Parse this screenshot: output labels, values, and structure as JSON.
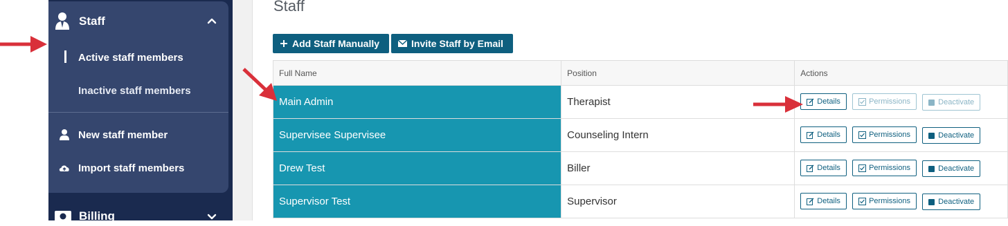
{
  "sidebar": {
    "staff_section": {
      "label": "Staff",
      "icon": "staff-person-icon",
      "expanded": true
    },
    "sub_items": [
      {
        "label": "Active staff members",
        "active": true
      },
      {
        "label": "Inactive staff members",
        "active": false
      }
    ],
    "menu_items": [
      {
        "label": "New staff member",
        "icon": "person-icon"
      },
      {
        "label": "Import staff members",
        "icon": "cloud-upload-icon"
      }
    ],
    "billing_section": {
      "label": "Billing",
      "icon": "money-icon",
      "expanded": false
    }
  },
  "main": {
    "title": "Staff",
    "buttons": {
      "add_manually": "Add Staff Manually",
      "invite_email": "Invite Staff by Email"
    },
    "table": {
      "headers": {
        "name": "Full Name",
        "position": "Position",
        "actions": "Actions"
      },
      "rows": [
        {
          "name": "Main Admin",
          "position": "Therapist",
          "actions_enabled": false
        },
        {
          "name": "Supervisee Supervisee",
          "position": "Counseling Intern",
          "actions_enabled": true
        },
        {
          "name": "Drew Test",
          "position": "Biller",
          "actions_enabled": true
        },
        {
          "name": "Supervisor Test",
          "position": "Supervisor",
          "actions_enabled": true
        }
      ],
      "action_labels": {
        "details": "Details",
        "permissions": "Permissions",
        "deactivate": "Deactivate"
      }
    }
  },
  "colors": {
    "sidebar_bg": "#1a2a4f",
    "sidebar_panel": "#35466e",
    "primary": "#0e5f7f",
    "name_cell": "#1796b0",
    "annotation_arrow": "#d9303a"
  }
}
